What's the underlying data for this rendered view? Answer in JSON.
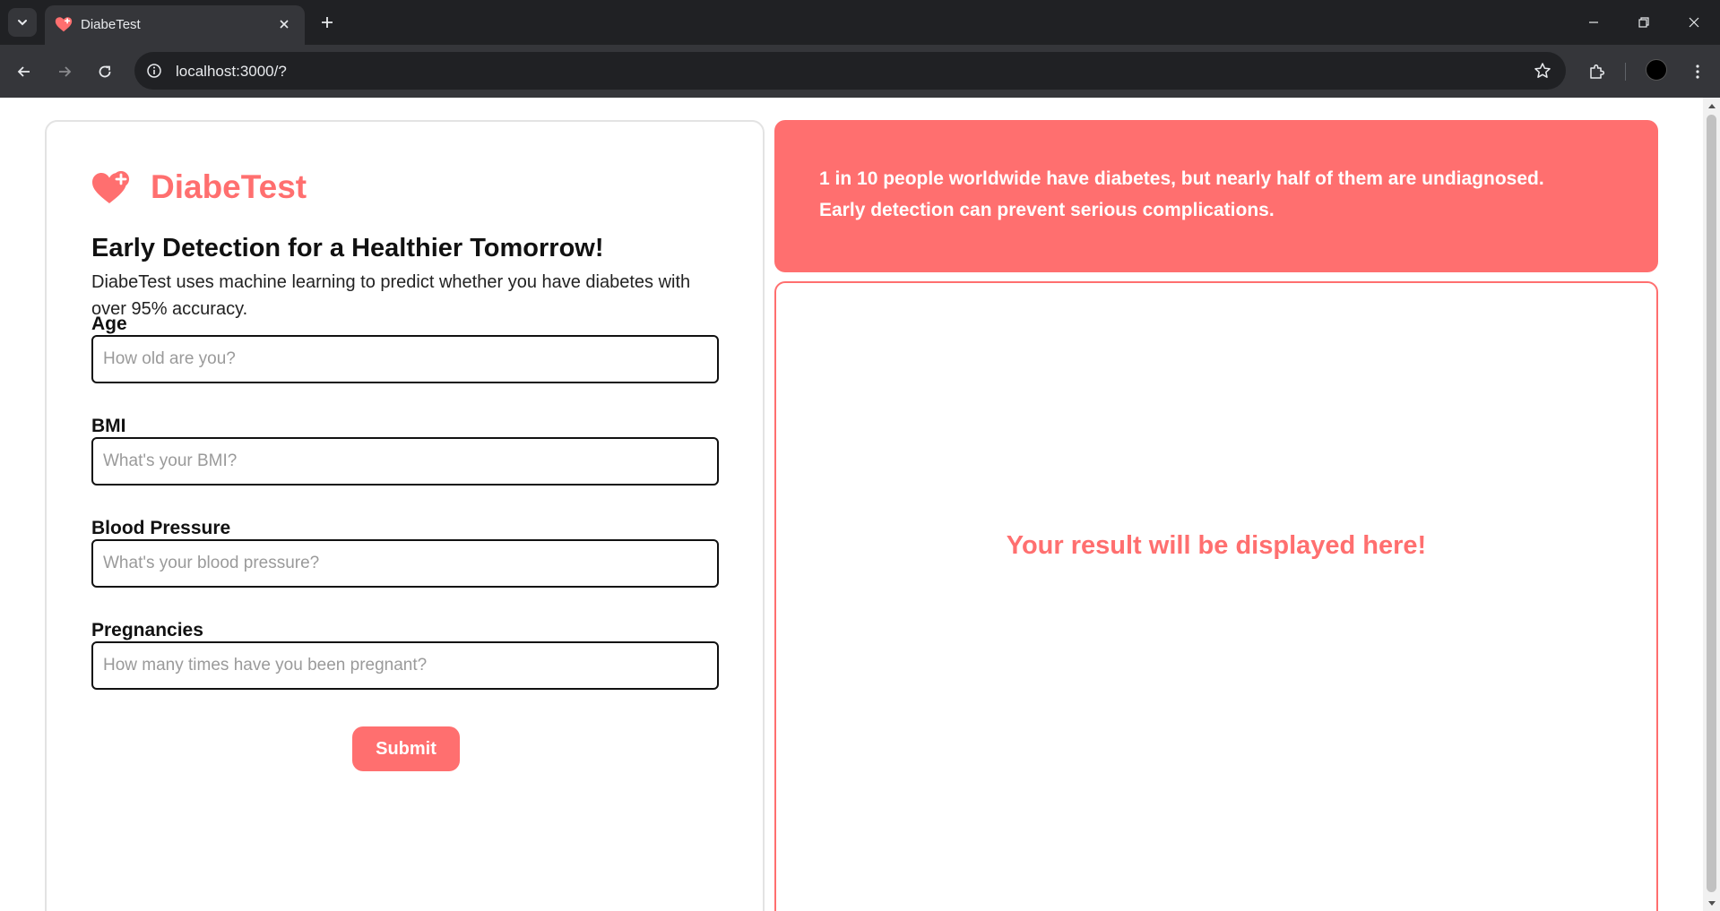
{
  "browser": {
    "tab_title": "DiabeTest",
    "url": "localhost:3000/?"
  },
  "brand": {
    "name": "DiabeTest",
    "color": "#ff6f6f"
  },
  "intro": {
    "headline": "Early Detection for a Healthier Tomorrow!",
    "description": "DiabeTest uses machine learning to predict whether you have diabetes with over 95% accuracy."
  },
  "form": {
    "fields": [
      {
        "label": "Age",
        "placeholder": "How old are you?"
      },
      {
        "label": "BMI",
        "placeholder": "What's your BMI?"
      },
      {
        "label": "Blood Pressure",
        "placeholder": "What's your blood pressure?"
      },
      {
        "label": "Pregnancies",
        "placeholder": "How many times have you been pregnant?"
      }
    ],
    "submit_label": "Submit"
  },
  "stat_banner": {
    "line1": "1 in 10 people worldwide have diabetes, but nearly half of them are undiagnosed.",
    "line2": "Early detection can prevent serious complications."
  },
  "result": {
    "placeholder_text": "Your result will be displayed here!"
  }
}
